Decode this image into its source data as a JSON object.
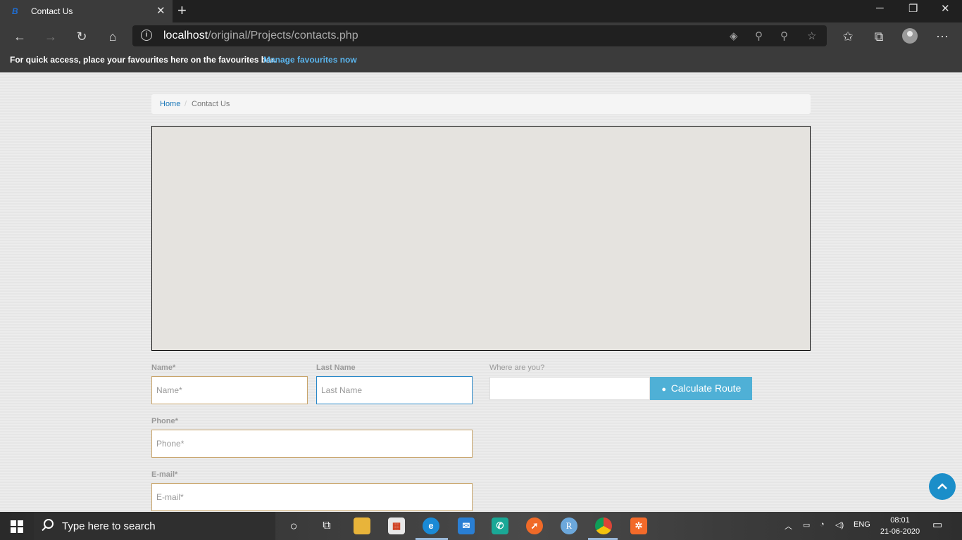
{
  "browser": {
    "tab_title": "Contact Us",
    "url_host": "localhost",
    "url_path": "/original/Projects/contacts.php",
    "favbar_text": "For quick access, place your favourites here on the favourites bar.",
    "favbar_link": "Manage favourites now"
  },
  "breadcrumb": {
    "home": "Home",
    "separator": "/",
    "current": "Contact Us"
  },
  "form": {
    "name_label": "Name*",
    "name_placeholder": "Name*",
    "last_name_label": "Last Name",
    "last_name_placeholder": "Last Name",
    "phone_label": "Phone*",
    "phone_placeholder": "Phone*",
    "email_label": "E-mail*",
    "email_placeholder": "E-mail*",
    "where_label": "Where are you?",
    "route_button": "Calculate Route"
  },
  "taskbar": {
    "search_text": "Type here to search",
    "language": "ENG",
    "time": "08:01",
    "date": "21-06-2020"
  },
  "colors": {
    "accent": "#4fb0d6",
    "link": "#1b78b9",
    "field_border": "#c8a46a",
    "focus_border": "#2a88c8",
    "scroll_top": "#1b8ec9"
  }
}
